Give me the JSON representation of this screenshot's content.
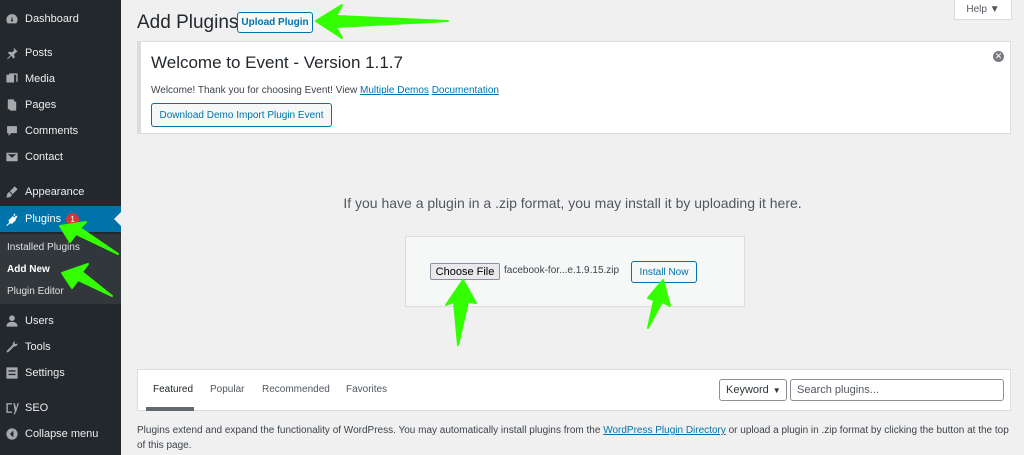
{
  "sidebar": {
    "items": [
      {
        "label": "Dashboard",
        "icon": "dashboard-icon"
      },
      {
        "label": "Posts",
        "icon": "pin-icon"
      },
      {
        "label": "Media",
        "icon": "media-icon"
      },
      {
        "label": "Pages",
        "icon": "pages-icon"
      },
      {
        "label": "Comments",
        "icon": "comments-icon"
      },
      {
        "label": "Contact",
        "icon": "mail-icon"
      },
      {
        "label": "Appearance",
        "icon": "brush-icon"
      },
      {
        "label": "Plugins",
        "icon": "plugin-icon",
        "badge": "1",
        "active": true
      },
      {
        "label": "Users",
        "icon": "user-icon"
      },
      {
        "label": "Tools",
        "icon": "wrench-icon"
      },
      {
        "label": "Settings",
        "icon": "settings-icon"
      },
      {
        "label": "SEO",
        "icon": "yoast-icon"
      },
      {
        "label": "Collapse menu",
        "icon": "collapse-icon"
      }
    ],
    "submenu": [
      "Installed Plugins",
      "Add New",
      "Plugin Editor"
    ]
  },
  "header": {
    "title": "Add Plugins",
    "upload_label": "Upload Plugin",
    "help_label": "Help ▼"
  },
  "notice": {
    "title": "Welcome to Event - Version 1.1.7",
    "text_prefix": "Welcome! Thank you for choosing Event! View ",
    "link_demos": "Multiple Demos",
    "link_docs": "Documentation",
    "button_label": "Download Demo Import Plugin Event",
    "dismiss": "✕"
  },
  "upload": {
    "help_text": "If you have a plugin in a .zip format, you may install it by uploading it here.",
    "choose_label": "Choose File",
    "file_name": "facebook-for...e.1.9.15.zip",
    "install_label": "Install Now"
  },
  "filter": {
    "tabs": [
      "Featured",
      "Popular",
      "Recommended",
      "Favorites"
    ],
    "keyword_label": "Keyword",
    "search_placeholder": "Search plugins..."
  },
  "footer": {
    "text_prefix": "Plugins extend and expand the functionality of WordPress. You may automatically install plugins from the ",
    "link": "WordPress Plugin Directory",
    "text_suffix": " or upload a plugin in .zip format by clicking the button at the top of this page."
  },
  "colors": {
    "sidebar_bg": "#23282d",
    "accent": "#0073aa",
    "annotation": "#33ff00"
  }
}
